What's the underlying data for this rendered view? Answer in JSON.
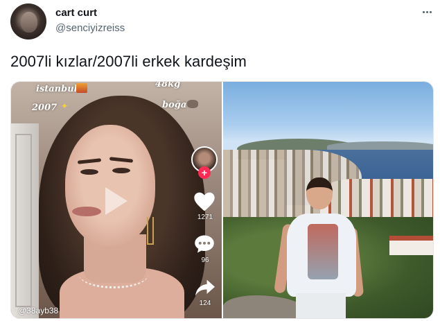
{
  "tweet": {
    "display_name": "cart curt",
    "handle": "@senciyizreiss",
    "text": "2007li kızlar/2007li erkek kardeşim"
  },
  "tiktok": {
    "overlay_city": "istanbul",
    "overlay_year": "2007",
    "overlay_weight": "48kg",
    "overlay_sign": "boğa",
    "likes": "1271",
    "comments": "96",
    "shares": "124",
    "username": "@38ayb38"
  },
  "icons": {
    "more": "more-dots-icon",
    "like": "heart-icon",
    "comment": "comment-icon",
    "share": "share-arrow-icon",
    "follow": "plus-icon",
    "play": "play-icon"
  },
  "colors": {
    "text_primary": "#0f1419",
    "text_secondary": "#536471",
    "tiktok_red": "#fe2c55"
  }
}
